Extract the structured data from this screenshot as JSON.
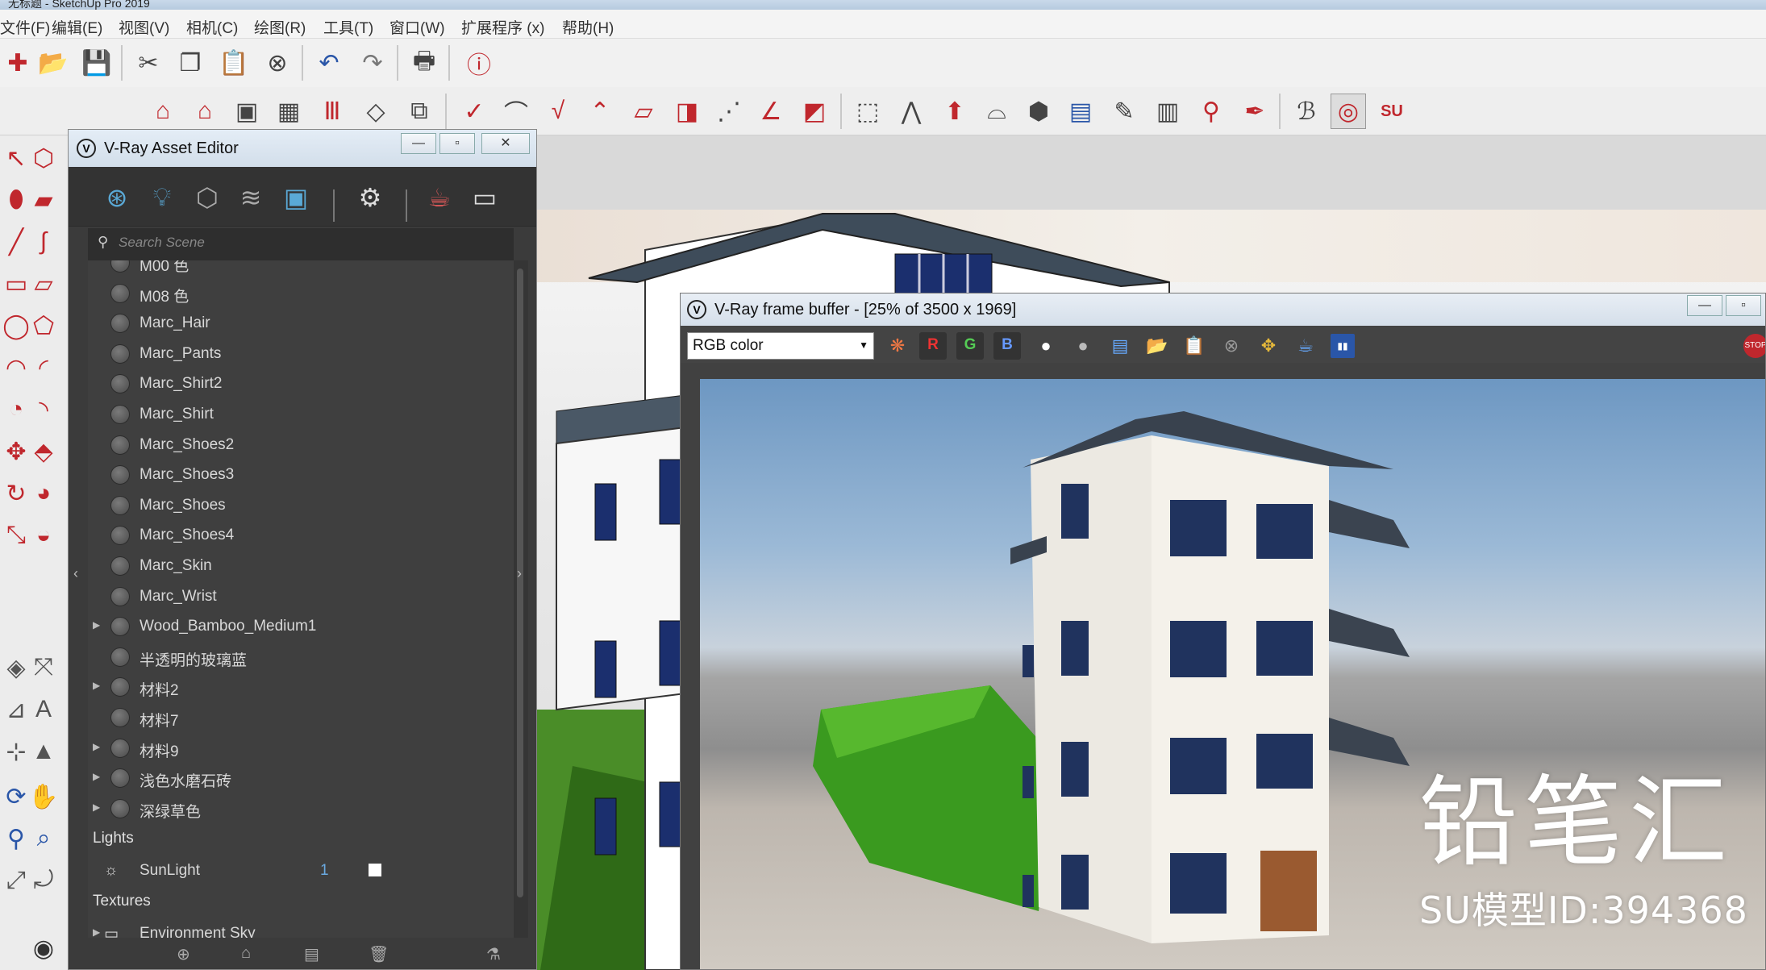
{
  "app": {
    "window_title_partial": "无标题 - SketchUp Pro 2019",
    "menus": [
      "文件(F)",
      "编辑(E)",
      "视图(V)",
      "相机(C)",
      "绘图(R)",
      "工具(T)",
      "窗口(W)",
      "扩展程序 (x)",
      "帮助(H)"
    ]
  },
  "asset_editor": {
    "title": "V-Ray Asset Editor",
    "search_placeholder": "Search Scene",
    "materials": [
      {
        "name": "M00 色",
        "expandable": false
      },
      {
        "name": "M08 色",
        "expandable": false
      },
      {
        "name": "Marc_Hair",
        "expandable": false
      },
      {
        "name": "Marc_Pants",
        "expandable": false
      },
      {
        "name": "Marc_Shirt2",
        "expandable": false
      },
      {
        "name": "Marc_Shirt",
        "expandable": false
      },
      {
        "name": "Marc_Shoes2",
        "expandable": false
      },
      {
        "name": "Marc_Shoes3",
        "expandable": false
      },
      {
        "name": "Marc_Shoes",
        "expandable": false
      },
      {
        "name": "Marc_Shoes4",
        "expandable": false
      },
      {
        "name": "Marc_Skin",
        "expandable": false
      },
      {
        "name": "Marc_Wrist",
        "expandable": false
      },
      {
        "name": "Wood_Bamboo_Medium1",
        "expandable": true
      },
      {
        "name": "半透明的玻璃蓝",
        "expandable": false
      },
      {
        "name": "材料2",
        "expandable": true
      },
      {
        "name": "材料7",
        "expandable": false
      },
      {
        "name": "材料9",
        "expandable": true
      },
      {
        "name": "浅色水磨石砖",
        "expandable": true
      },
      {
        "name": "深绿草色",
        "expandable": true
      }
    ],
    "lights_header": "Lights",
    "lights": [
      {
        "name": "SunLight",
        "count": "1"
      }
    ],
    "textures_header": "Textures",
    "textures": [
      {
        "name": "Environment Sky"
      }
    ]
  },
  "frame_buffer": {
    "title": "V-Ray frame buffer - [25% of 3500 x 1969]",
    "channel": "RGB color",
    "channel_buttons": [
      "R",
      "G",
      "B"
    ]
  },
  "watermark": {
    "brand": "铅笔汇",
    "model_id": "SU模型ID:394368"
  },
  "colors": {
    "vray_blue": "#5aa9d6",
    "panel_dark": "#3f3f3f",
    "r_button": "#c0392b",
    "g_button": "#4caf50",
    "b_button": "#3b6fc4"
  }
}
